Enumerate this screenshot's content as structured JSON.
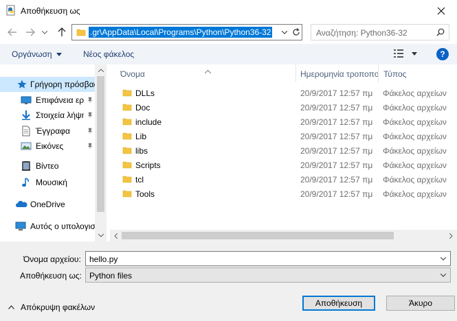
{
  "window": {
    "title": "Αποθήκευση ως"
  },
  "address": {
    "path": ".gr\\AppData\\Local\\Programs\\Python\\Python36-32"
  },
  "search": {
    "placeholder": "Αναζήτηση: Python36-32"
  },
  "toolbar": {
    "organize_label": "Οργάνωση",
    "new_folder_label": "Νέος φάκελος",
    "help_label": "?"
  },
  "nav": {
    "items": [
      {
        "label": "Γρήγορη πρόσβαση",
        "icon": "star-icon",
        "pinned": false,
        "selected": true
      },
      {
        "label": "Επιφάνεια εργασίας",
        "icon": "desktop-icon",
        "pinned": true
      },
      {
        "label": "Στοιχεία λήψης",
        "icon": "download-icon",
        "pinned": true
      },
      {
        "label": "Έγγραφα",
        "icon": "document-icon",
        "pinned": true
      },
      {
        "label": "Εικόνες",
        "icon": "pictures-icon",
        "pinned": true
      },
      {
        "label": "Βίντεο",
        "icon": "video-icon",
        "pinned": false
      },
      {
        "label": "Μουσική",
        "icon": "music-icon",
        "pinned": false
      },
      {
        "label": "OneDrive",
        "icon": "onedrive-icon",
        "pinned": false
      },
      {
        "label": "Αυτός ο υπολογιστής",
        "icon": "computer-icon",
        "pinned": false
      }
    ]
  },
  "columns": {
    "name": "Όνομα",
    "date": "Ημερομηνία τροποποίησης",
    "type": "Τύπος"
  },
  "files": [
    {
      "name": "DLLs",
      "date": "20/9/2017 12:57 πμ",
      "type": "Φάκελος αρχείων"
    },
    {
      "name": "Doc",
      "date": "20/9/2017 12:57 πμ",
      "type": "Φάκελος αρχείων"
    },
    {
      "name": "include",
      "date": "20/9/2017 12:57 πμ",
      "type": "Φάκελος αρχείων"
    },
    {
      "name": "Lib",
      "date": "20/9/2017 12:57 πμ",
      "type": "Φάκελος αρχείων"
    },
    {
      "name": "libs",
      "date": "20/9/2017 12:57 πμ",
      "type": "Φάκελος αρχείων"
    },
    {
      "name": "Scripts",
      "date": "20/9/2017 12:57 πμ",
      "type": "Φάκελος αρχείων"
    },
    {
      "name": "tcl",
      "date": "20/9/2017 12:57 πμ",
      "type": "Φάκελος αρχείων"
    },
    {
      "name": "Tools",
      "date": "20/9/2017 12:57 πμ",
      "type": "Φάκελος αρχείων"
    }
  ],
  "form": {
    "filename_label": "Όνομα αρχείου:",
    "filename_value": "hello.py",
    "savetype_label": "Αποθήκευση ως:",
    "savetype_value": "Python files"
  },
  "footer": {
    "hide_folders_label": "Απόκρυψη φακέλων",
    "save_label": "Αποθήκευση",
    "cancel_label": "Άκυρο"
  },
  "colors": {
    "accent": "#0078d7",
    "selection": "#cce8ff",
    "folder": "#f5c542"
  }
}
